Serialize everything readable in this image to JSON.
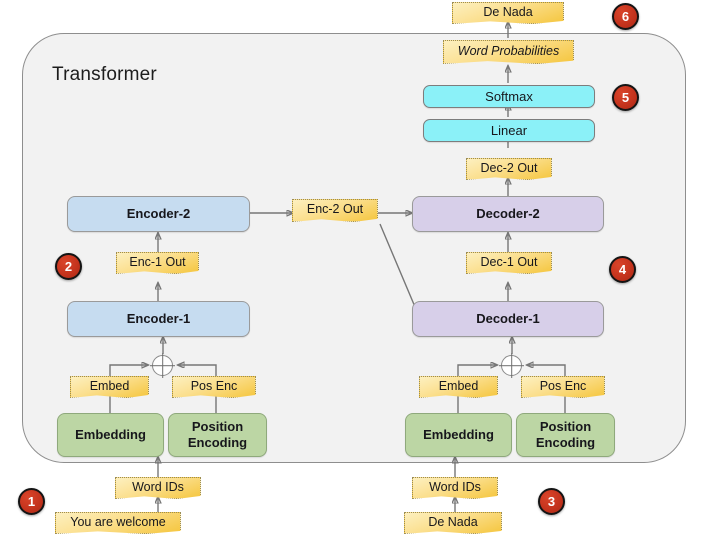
{
  "diagram": {
    "title": "Transformer",
    "type": "transformer-architecture-block-diagram"
  },
  "encoder_stack": {
    "encoder_1": "Encoder-1",
    "encoder_2": "Encoder-2",
    "enc_1_out": "Enc-1 Out",
    "enc_2_out": "Enc-2 Out",
    "embed_note": "Embed",
    "pos_enc_note": "Pos Enc",
    "embedding_box": "Embedding",
    "position_encoding_box": "Position\nEncoding",
    "position_encoding_line1": "Position",
    "position_encoding_line2": "Encoding",
    "word_ids": "Word IDs",
    "source_sentence": "You are welcome"
  },
  "decoder_stack": {
    "decoder_1": "Decoder-1",
    "decoder_2": "Decoder-2",
    "dec_1_out": "Dec-1 Out",
    "dec_2_out": "Dec-2 Out",
    "embed_note": "Embed",
    "pos_enc_note": "Pos Enc",
    "embedding_box": "Embedding",
    "position_encoding_line1": "Position",
    "position_encoding_line2": "Encoding",
    "word_ids": "Word IDs",
    "target_sentence": "De Nada"
  },
  "output_head": {
    "linear": "Linear",
    "softmax": "Softmax",
    "word_probabilities": "Word Probabilities",
    "output_sentence": "De Nada"
  },
  "badges": [
    {
      "number": "1",
      "describes": "source-word-ids-input"
    },
    {
      "number": "2",
      "describes": "encoder-stack"
    },
    {
      "number": "3",
      "describes": "target-word-ids-input"
    },
    {
      "number": "4",
      "describes": "decoder-stack"
    },
    {
      "number": "5",
      "describes": "linear-softmax-head"
    },
    {
      "number": "6",
      "describes": "final-output"
    }
  ],
  "colors": {
    "container_fill": "#f2f2f2",
    "container_border": "#8e8e8e",
    "encoder_fill": "#c6dcf0",
    "decoder_fill": "#d7cfe9",
    "embedding_fill": "#bcd6a4",
    "head_fill": "#8bf1f8",
    "note_fill": "#f5c63f",
    "badge_fill": "#c3321c",
    "wire": "#767676"
  }
}
